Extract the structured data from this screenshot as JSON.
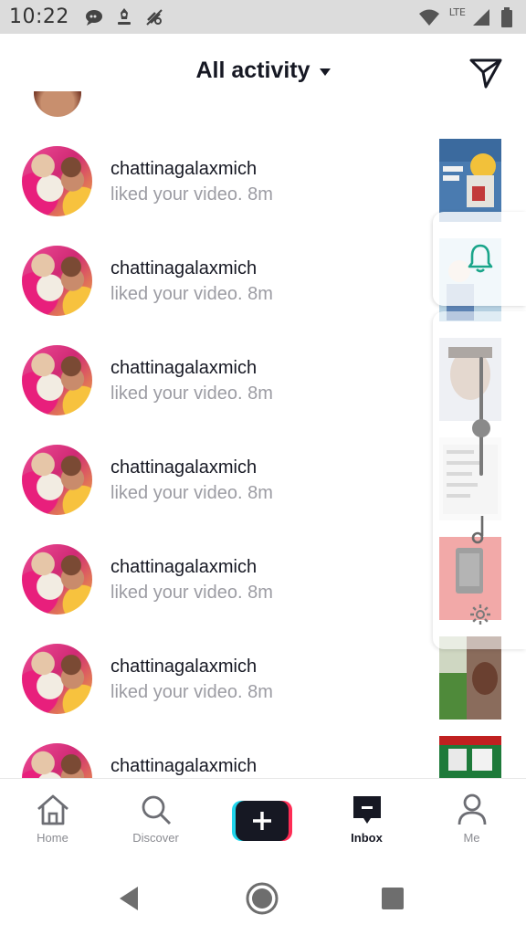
{
  "status_bar": {
    "time": "10:22",
    "network": "LTE",
    "icons": [
      "chat-bubble-icon",
      "settings-badge-icon",
      "mute-icon",
      "wifi-icon",
      "signal-icon",
      "battery-icon"
    ]
  },
  "header": {
    "title": "All activity",
    "dropdown_icon": "caret-down-icon",
    "send_icon": "send-icon"
  },
  "notifications": [
    {
      "username": "chattinagalaxmich",
      "action": "liked your video.",
      "time": "8m"
    },
    {
      "username": "chattinagalaxmich",
      "action": "liked your video.",
      "time": "8m"
    },
    {
      "username": "chattinagalaxmich",
      "action": "liked your video.",
      "time": "8m"
    },
    {
      "username": "chattinagalaxmich",
      "action": "liked your video.",
      "time": "8m"
    },
    {
      "username": "chattinagalaxmich",
      "action": "liked your video.",
      "time": "8m"
    },
    {
      "username": "chattinagalaxmich",
      "action": "liked your video.",
      "time": "8m"
    },
    {
      "username": "chattinagalaxmich",
      "action": "",
      "time": ""
    }
  ],
  "overlay": {
    "bell_icon": "bell-icon",
    "volume_slider_icon": "volume-slider",
    "music_icon": "music-note-icon",
    "settings_icon": "gear-icon",
    "accent_color": "#1aa58a"
  },
  "bottom_nav": {
    "items": [
      {
        "label": "Home",
        "icon": "home-icon"
      },
      {
        "label": "Discover",
        "icon": "search-icon"
      },
      {
        "label": "",
        "icon": "plus-icon"
      },
      {
        "label": "Inbox",
        "icon": "inbox-icon",
        "active": true
      },
      {
        "label": "Me",
        "icon": "person-icon"
      }
    ]
  },
  "system_nav": [
    "back-icon",
    "home-circle-icon",
    "recents-icon"
  ],
  "colors": {
    "brand_cyan": "#20d5ec",
    "brand_red": "#fe2c55",
    "text_primary": "#161823",
    "text_secondary": "#9c9ca3"
  }
}
